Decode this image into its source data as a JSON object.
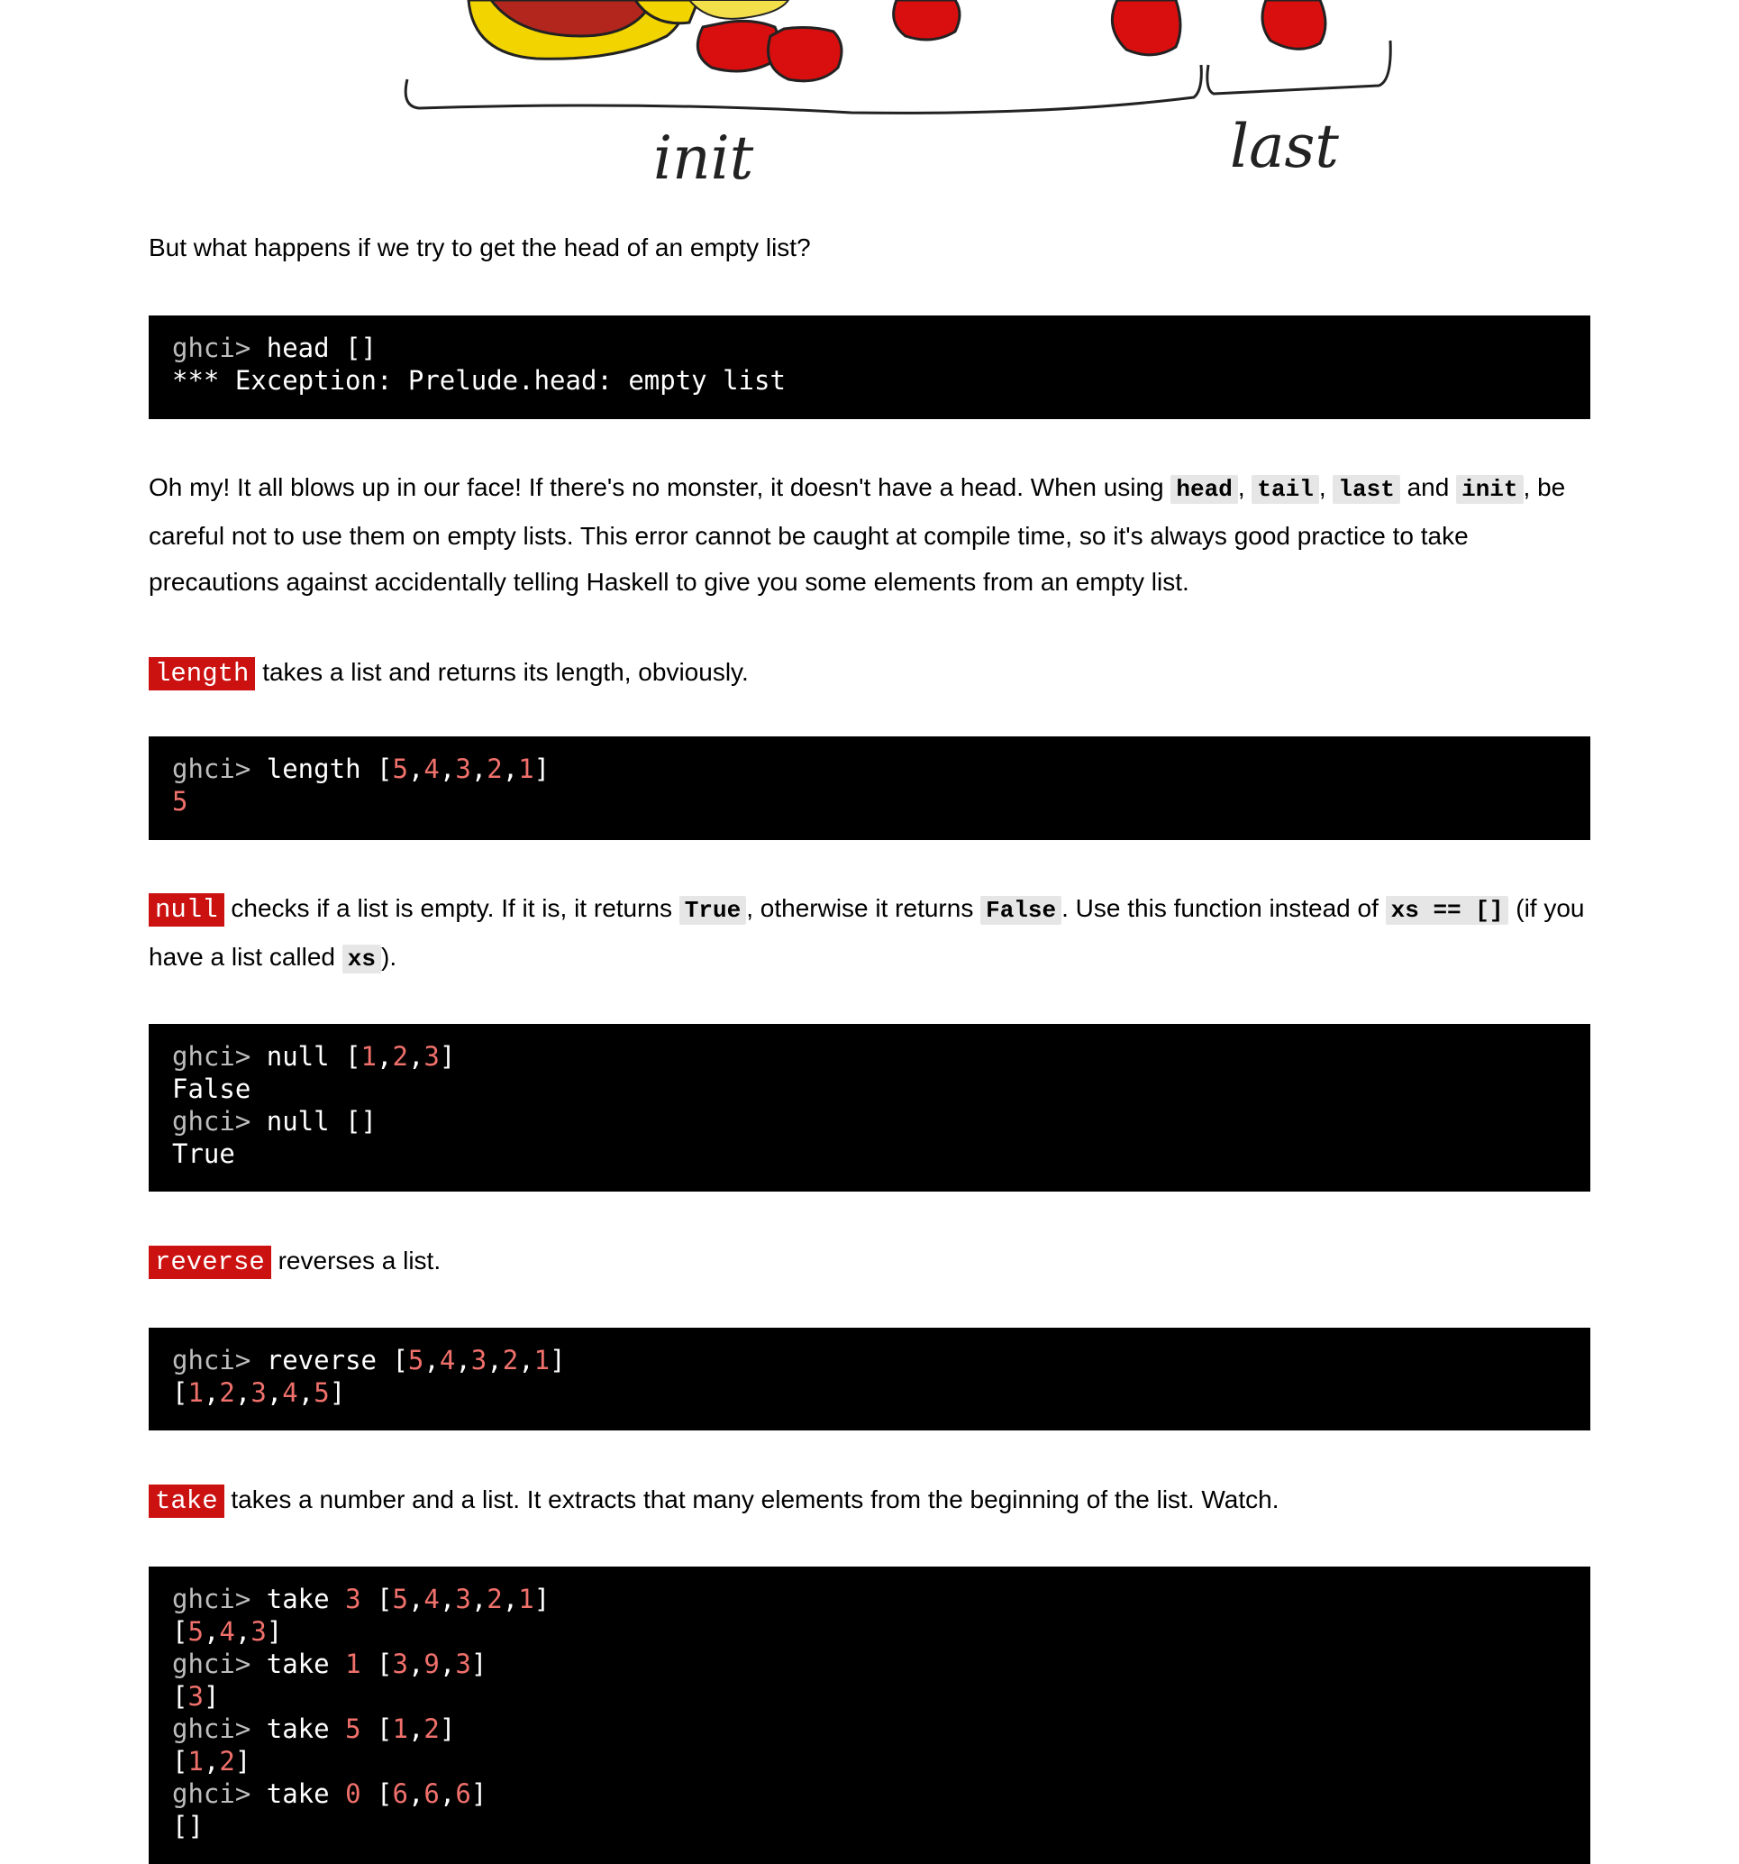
{
  "illustration": {
    "labels": {
      "init": "init",
      "last": "last"
    }
  },
  "paragraphs": {
    "empty_head_question": "But what happens if we try to get the head of an empty list?",
    "oh_my": {
      "t1": "Oh my! It all blows up in our face! If there's no monster, it doesn't have a head. When using ",
      "c_head": "head",
      "t2": ", ",
      "c_tail": "tail",
      "t3": ", ",
      "c_last": "last",
      "t4": " and ",
      "c_init": "init",
      "t5": ", be careful not to use them on empty lists. This error cannot be caught at compile time, so it's always good practice to take precautions against accidentally telling Haskell to give you some elements from an empty list."
    },
    "length": {
      "fn": "length",
      "text": " takes a list and returns its length, obviously."
    },
    "null": {
      "fn": "null",
      "t1": " checks if a list is empty. If it is, it returns ",
      "c_true": "True",
      "t2": ", otherwise it returns ",
      "c_false": "False",
      "t3": ". Use this function instead of ",
      "c_xs_eq": "xs == []",
      "t4": " (if you have a list called ",
      "c_xs": "xs",
      "t5": ")."
    },
    "reverse": {
      "fn": "reverse",
      "text": " reverses a list."
    },
    "take": {
      "fn": "take",
      "text": " takes a number and a list. It extracts that many elements from the beginning of the list. Watch."
    }
  },
  "code_blocks": {
    "head_empty": {
      "prompt": "ghci> ",
      "cmd": "head []",
      "output": "*** Exception: Prelude.head: empty list"
    },
    "length": {
      "prompt": "ghci> ",
      "cmd": "length ",
      "list_open": "[",
      "list_items": [
        "5",
        "4",
        "3",
        "2",
        "1"
      ],
      "list_close": "]",
      "result": "5"
    },
    "null": {
      "l1_prompt": "ghci> ",
      "l1_cmd": "null ",
      "l1_list": [
        "1",
        "2",
        "3"
      ],
      "l2": "False",
      "l3_prompt": "ghci> ",
      "l3_cmd": "null []",
      "l4": "True"
    },
    "reverse": {
      "prompt": "ghci> ",
      "cmd": "reverse ",
      "input": [
        "5",
        "4",
        "3",
        "2",
        "1"
      ],
      "result": [
        "1",
        "2",
        "3",
        "4",
        "5"
      ]
    },
    "take": {
      "prompt": "ghci> ",
      "cmd": "take ",
      "examples": [
        {
          "n": "3",
          "input": [
            "5",
            "4",
            "3",
            "2",
            "1"
          ],
          "result": [
            "5",
            "4",
            "3"
          ]
        },
        {
          "n": "1",
          "input": [
            "3",
            "9",
            "3"
          ],
          "result": [
            "3"
          ]
        },
        {
          "n": "5",
          "input": [
            "1",
            "2"
          ],
          "result": [
            "1",
            "2"
          ]
        },
        {
          "n": "0",
          "input": [
            "6",
            "6",
            "6"
          ],
          "result": []
        }
      ]
    }
  }
}
